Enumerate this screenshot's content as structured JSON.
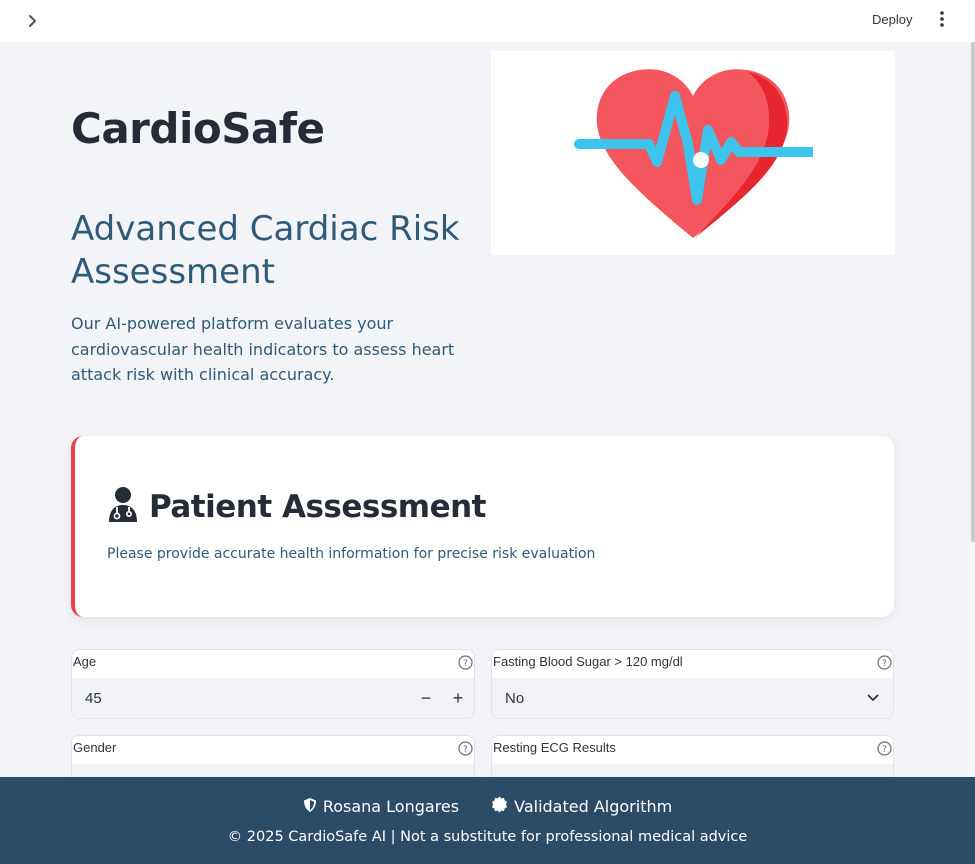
{
  "topbar": {
    "sidebar_toggle_icon": "chevron-right-icon",
    "deploy_label": "Deploy",
    "menu_icon": "kebab-menu-icon"
  },
  "hero": {
    "title": "CardioSafe",
    "subtitle": "Advanced Cardiac Risk Assessment",
    "intro": "Our AI-powered platform evaluates your cardiovascular health indicators to assess heart attack risk with clinical accuracy.",
    "image_icon": "heart-pulse-icon"
  },
  "assessment": {
    "icon": "doctor-icon",
    "title": "Patient Assessment",
    "description": "Please provide accurate health information for precise risk evaluation",
    "accent_color": "#e8434b"
  },
  "form": {
    "age": {
      "label": "Age",
      "value": "45",
      "minus": "−",
      "plus": "+"
    },
    "fasting_blood_sugar": {
      "label": "Fasting Blood Sugar > 120 mg/dl",
      "value": "No"
    },
    "gender": {
      "label": "Gender"
    },
    "resting_ecg": {
      "label": "Resting ECG Results"
    }
  },
  "footer": {
    "author": "Rosana Longares",
    "author_icon": "shield-icon",
    "validated": "Validated Algorithm",
    "validated_icon": "certificate-icon",
    "copyright": "© 2025 CardioSafe AI | Not a substitute for professional medical advice",
    "background": "#2c4b66"
  }
}
